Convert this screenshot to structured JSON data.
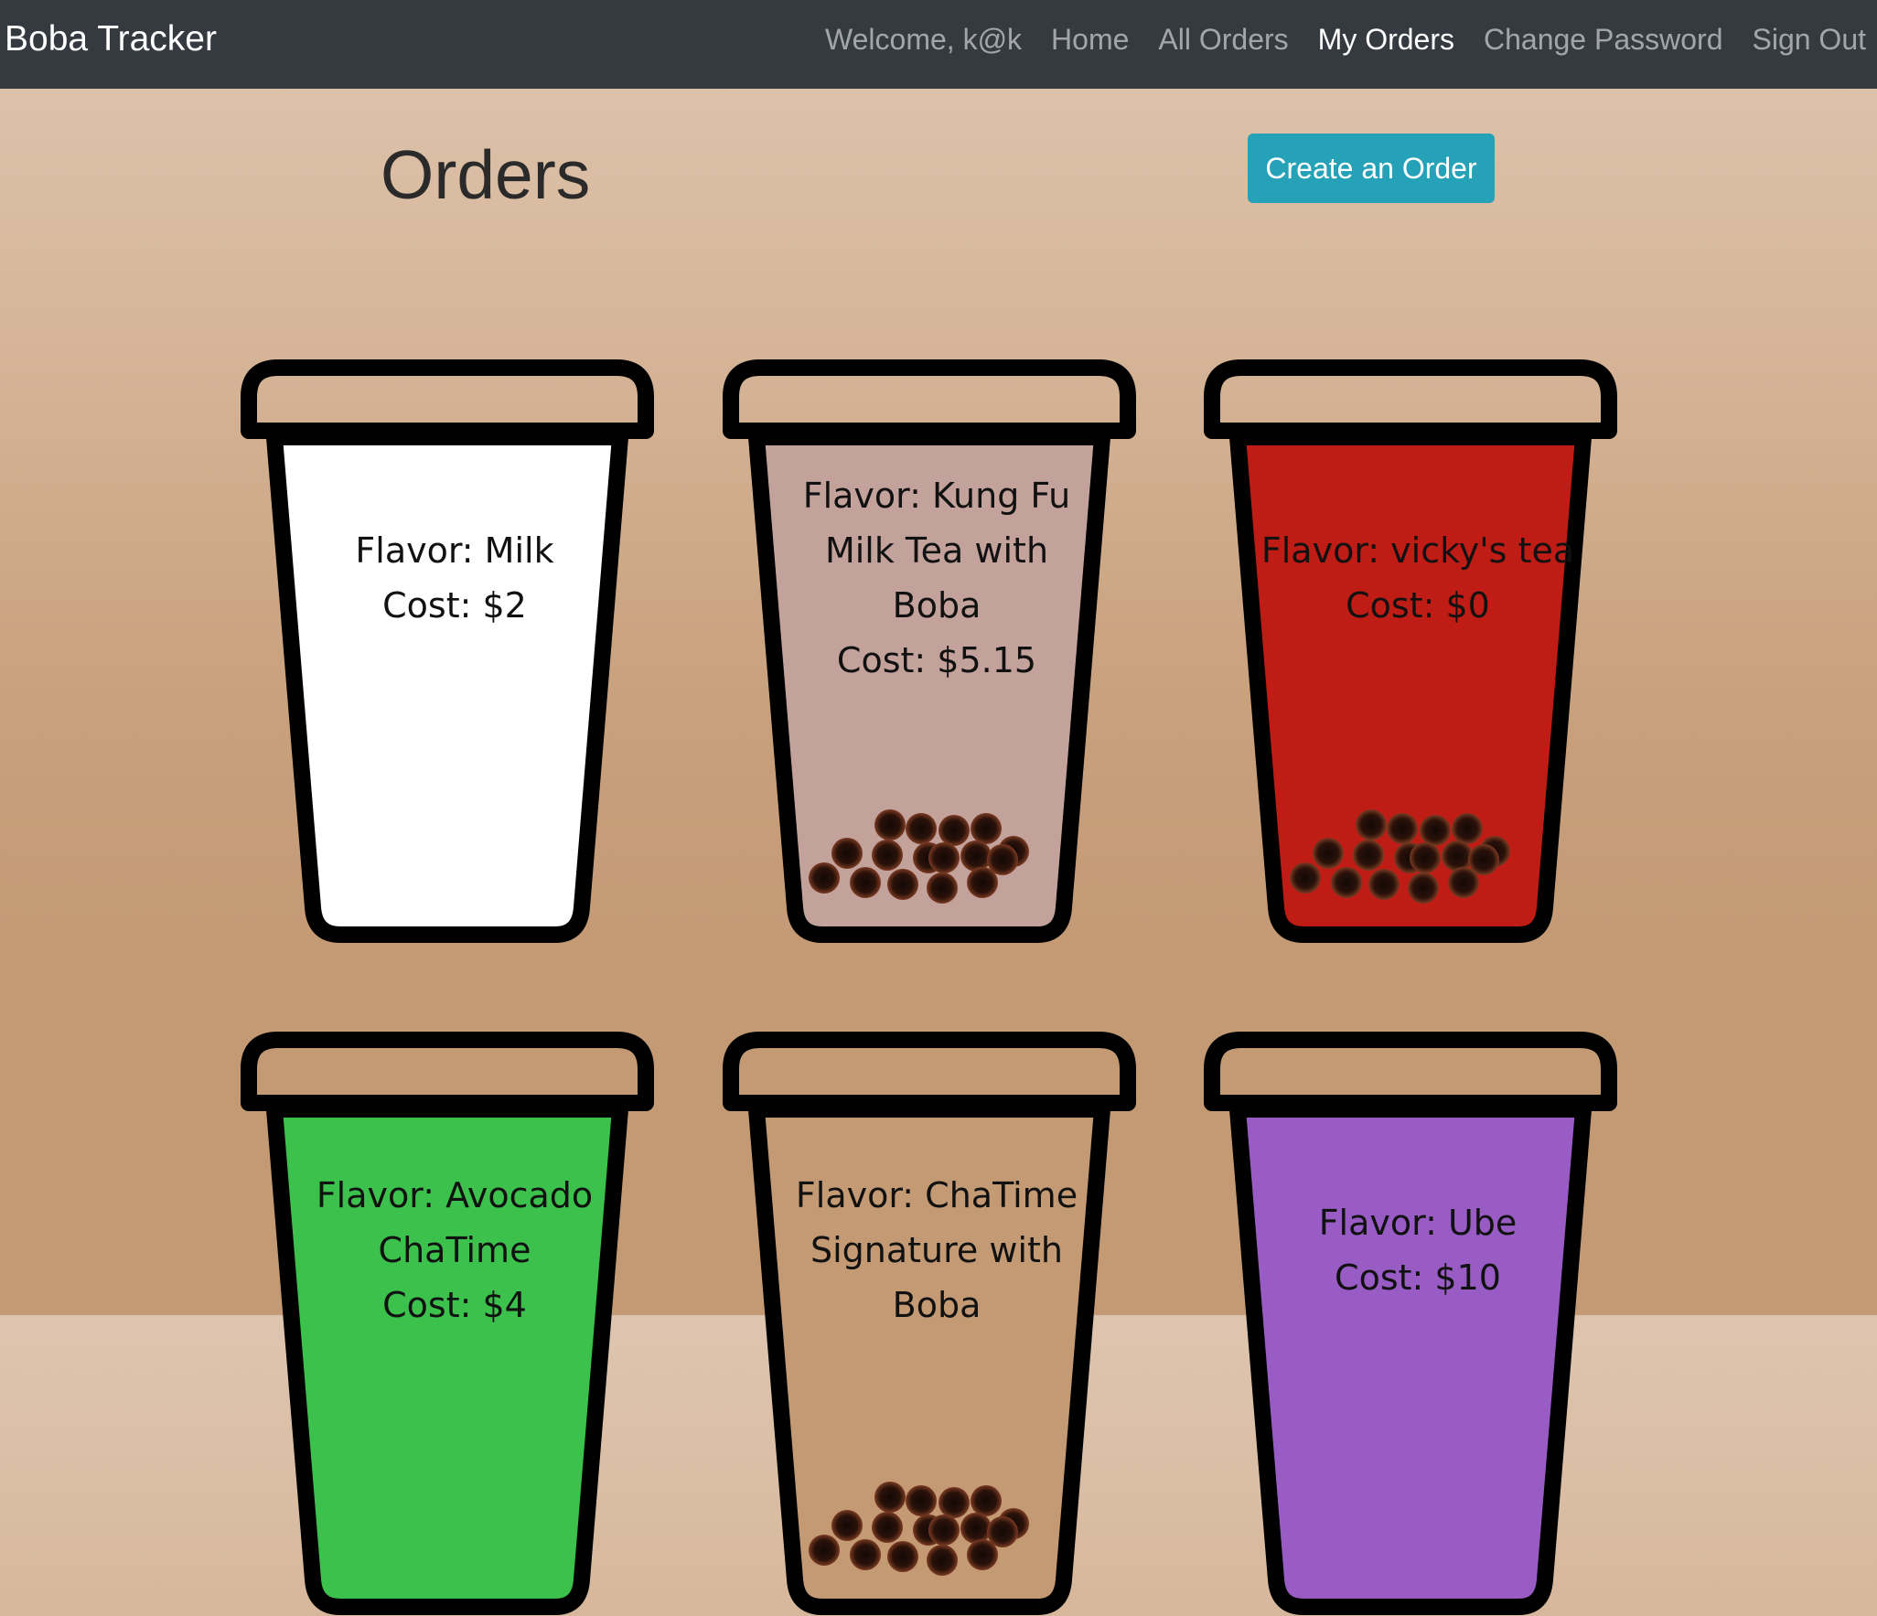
{
  "nav": {
    "brand": "Boba Tracker",
    "welcome": "Welcome, k@k",
    "links": [
      "Home",
      "All Orders",
      "My Orders",
      "Change Password",
      "Sign Out"
    ],
    "active": "My Orders"
  },
  "main": {
    "title": "Orders",
    "create_button": "Create an Order"
  },
  "orders": [
    {
      "flavor": "Flavor: Milk",
      "cost": "Cost: $2",
      "color": "#ffffff",
      "boba": false
    },
    {
      "flavor": "Flavor: Kung Fu Milk Tea with Boba",
      "cost": "Cost: $5.15",
      "color": "#c4a29c",
      "boba": true
    },
    {
      "flavor": "Flavor: vicky's tea",
      "cost": "Cost: $0",
      "color": "#c01c16",
      "boba": true
    },
    {
      "flavor": "Flavor: Avocado ChaTime",
      "cost": "Cost: $4",
      "color": "#3bc14c",
      "boba": false
    },
    {
      "flavor": "Flavor: ChaTime Signature with Boba",
      "cost": "",
      "color": "#c39a74",
      "boba": true
    },
    {
      "flavor": "Flavor: Ube",
      "cost": "Cost: $10",
      "color": "#985cc4",
      "boba": false
    }
  ],
  "colors": {
    "nav_bg": "#343a40",
    "button": "#25a2b8",
    "cup_outline": "#000000",
    "pearl": "#3b1a10"
  }
}
